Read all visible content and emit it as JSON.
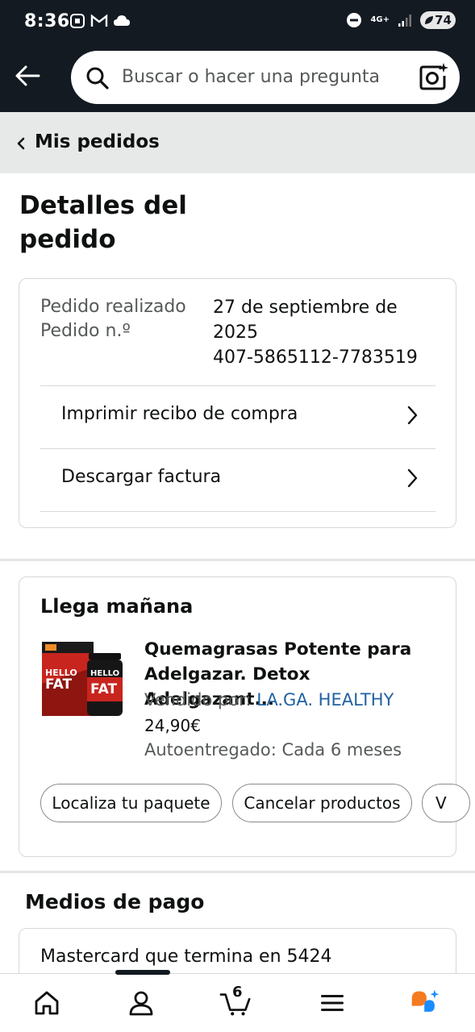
{
  "status_bar": {
    "time": "8:36",
    "network": "4G+",
    "battery": "74"
  },
  "search": {
    "placeholder": "Buscar o hacer una pregunta"
  },
  "breadcrumb": {
    "label": "Mis pedidos"
  },
  "page": {
    "title": "Detalles del pedido"
  },
  "order": {
    "placed_label": "Pedido realizado",
    "number_label": "Pedido n.º",
    "placed_date_line1": "27 de septiembre de",
    "placed_date_line2": "2025",
    "order_number": "407-5865112-7783519",
    "print_receipt": "Imprimir recibo de compra",
    "download_invoice": "Descargar factura"
  },
  "delivery": {
    "status": "Llega mañana",
    "product_title": "Quemagrasas Potente para Adelgazar. Detox Adelgazant...",
    "sold_by_label": "Vendido por:",
    "seller": "LA.GA. HEALTHY",
    "price": "24,90€",
    "subscription": "Autoentregado: Cada 6 meses",
    "image_text_1": "HELLO",
    "image_text_2": "FAT",
    "actions": {
      "track": "Localiza tu paquete",
      "cancel": "Cancelar productos",
      "more": "V"
    }
  },
  "payment": {
    "title": "Medios de pago",
    "method": "Mastercard  que termina en 5424"
  },
  "bottom_nav": {
    "cart_count": "6"
  },
  "colors": {
    "header_bg": "#131a22",
    "breadcrumb_bg": "#e7e8e8",
    "link": "#2162a1",
    "rufus_orange": "#f47b20",
    "rufus_blue": "#1a8cff"
  }
}
